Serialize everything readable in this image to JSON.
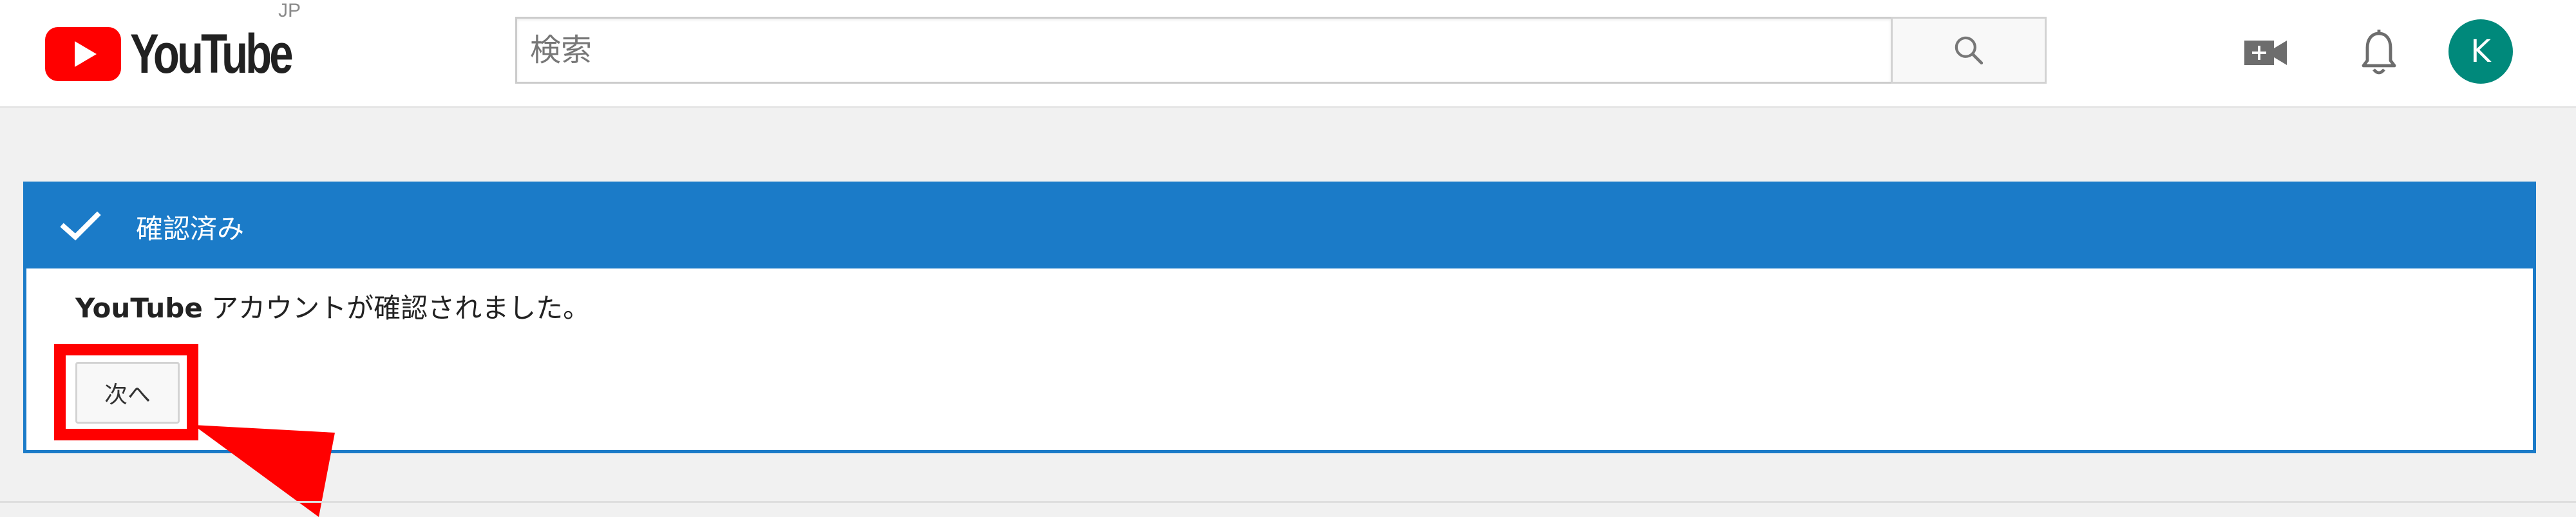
{
  "masthead": {
    "logo_text": "YouTube",
    "country_code": "JP",
    "search": {
      "placeholder": "検索",
      "value": ""
    },
    "icons": {
      "search_button": "search-icon",
      "upload": "video-camera-plus-icon",
      "notifications": "bell-icon"
    },
    "avatar_initial": "K"
  },
  "panel": {
    "title": "確認済み",
    "message_brand": "YouTube",
    "message_text": " アカウントが確認されました。",
    "next_button_label": "次へ"
  },
  "colors": {
    "brand_red": "#ff0000",
    "panel_blue": "#1b7bc8",
    "avatar_green": "#00897b",
    "annotation_red": "#ff0000"
  }
}
